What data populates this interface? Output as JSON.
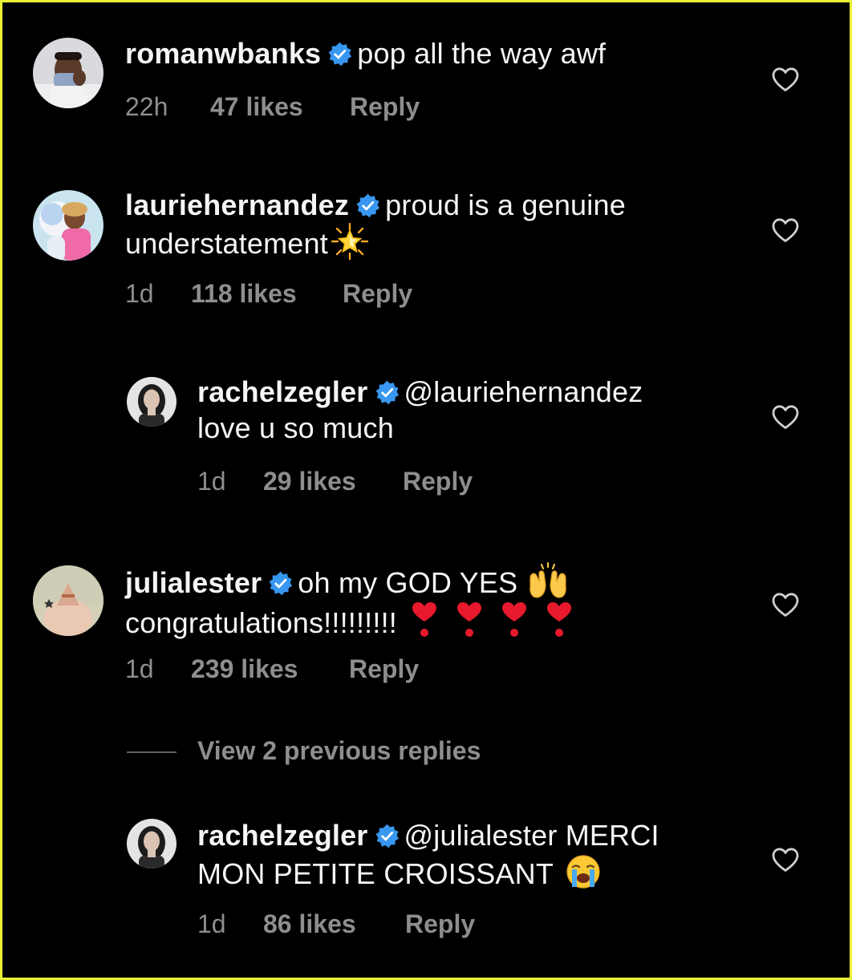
{
  "comments": [
    {
      "username": "romanwbanks",
      "text_line1": "pop all the way awf",
      "text_line2": "",
      "time": "22h",
      "likes": "47 likes",
      "reply": "Reply"
    },
    {
      "username": "lauriehernandez",
      "text_line1": "proud is a genuine",
      "text_line2": "understatement",
      "time": "1d",
      "likes": "118 likes",
      "reply": "Reply"
    },
    {
      "username": "rachelzegler",
      "text_line1": "@lauriehernandez",
      "text_line2": "love u so much",
      "time": "1d",
      "likes": "29 likes",
      "reply": "Reply"
    },
    {
      "username": "julialester",
      "text_line1": "oh my GOD YES",
      "text_line2": "congratulations!!!!!!!!!",
      "time": "1d",
      "likes": "239 likes",
      "reply": "Reply"
    },
    {
      "username": "rachelzegler",
      "text_line1": "@julialester MERCI",
      "text_line2": "MON PETITE CROISSANT",
      "time": "1d",
      "likes": "86 likes",
      "reply": "Reply"
    }
  ],
  "view_replies_label": "View 2 previous replies",
  "icons": {
    "verified": "verified-badge-icon",
    "like": "heart-outline-icon",
    "emoji_star": "glowing-star-emoji",
    "emoji_hands": "raising-hands-emoji",
    "emoji_heart": "heart-exclamation-emoji",
    "emoji_cry": "loudly-crying-face-emoji"
  },
  "colors": {
    "background": "#000000",
    "text": "#f5f5f5",
    "meta": "#8e8e8e",
    "verified": "#3897f0",
    "border": "#e9f235"
  }
}
